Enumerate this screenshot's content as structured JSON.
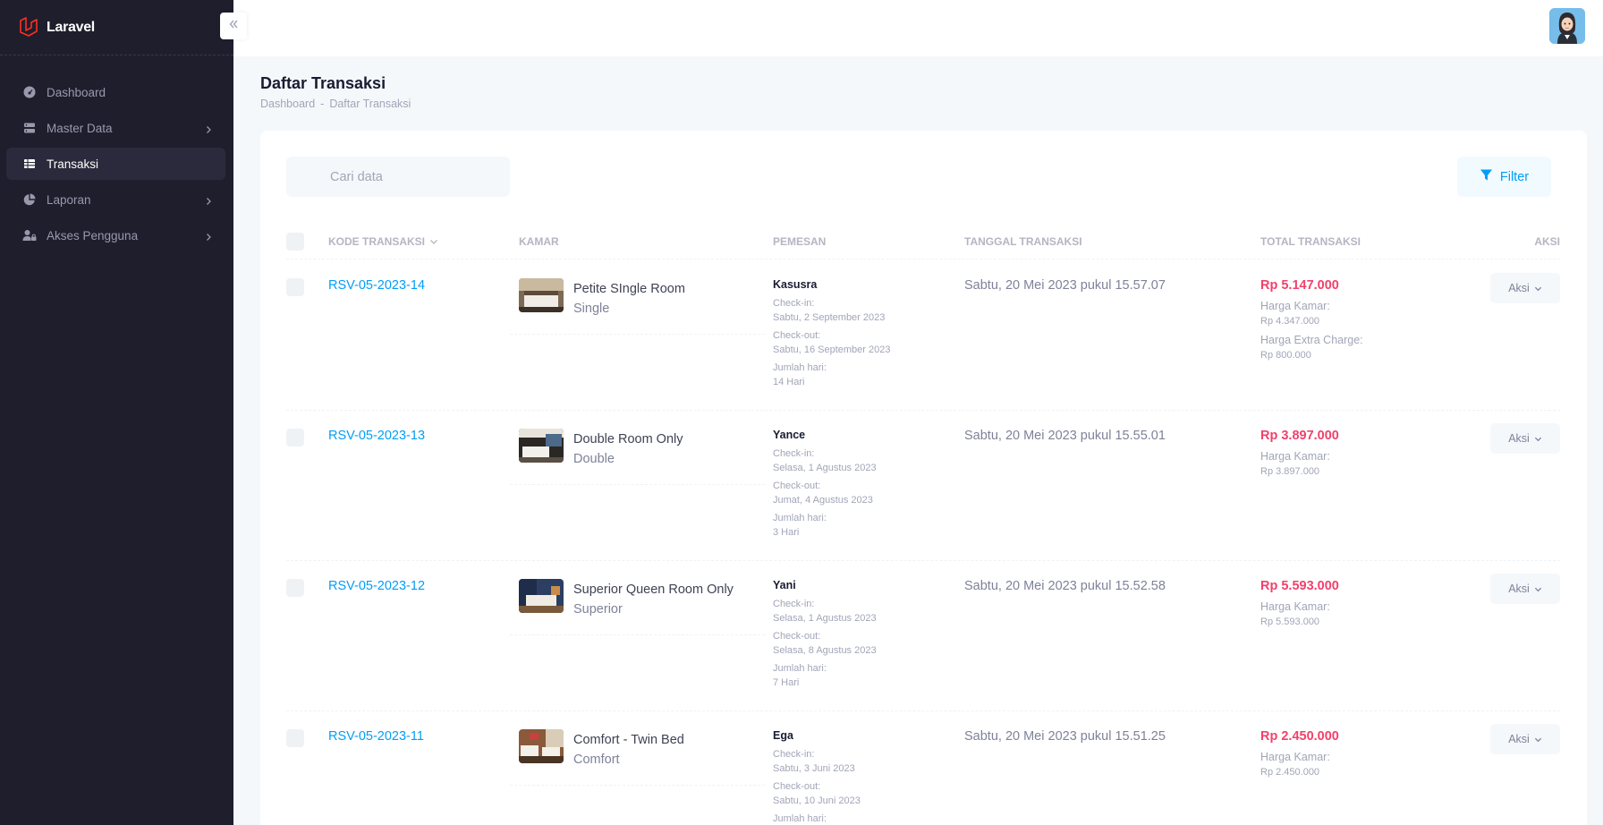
{
  "app": {
    "name": "Laravel"
  },
  "sidebar": {
    "items": [
      {
        "label": "Dashboard",
        "icon": "dashboard-icon",
        "active": false,
        "submenu": false
      },
      {
        "label": "Master Data",
        "icon": "database-icon",
        "active": false,
        "submenu": true
      },
      {
        "label": "Transaksi",
        "icon": "table-icon",
        "active": true,
        "submenu": false
      },
      {
        "label": "Laporan",
        "icon": "pie-chart-icon",
        "active": false,
        "submenu": true
      },
      {
        "label": "Akses Pengguna",
        "icon": "user-lock-icon",
        "active": false,
        "submenu": true
      }
    ]
  },
  "page": {
    "title": "Daftar Transaksi",
    "breadcrumb": [
      "Dashboard",
      "-",
      "Daftar Transaksi"
    ]
  },
  "toolbar": {
    "search_placeholder": "Cari data",
    "filter_label": "Filter"
  },
  "table": {
    "columns": {
      "code": "KODE TRANSAKSI",
      "room": "KAMAR",
      "guest": "PEMESAN",
      "date": "TANGGAL TRANSAKSI",
      "total": "TOTAL TRANSAKSI",
      "action": "AKSI"
    },
    "labels": {
      "checkin": "Check-in:",
      "checkout": "Check-out:",
      "days": "Jumlah hari:",
      "room_price": "Harga Kamar:",
      "extra_charge": "Harga Extra Charge:",
      "action_button": "Aksi"
    },
    "rows": [
      {
        "code": "RSV-05-2023-14",
        "room_name": "Petite SIngle Room",
        "room_type": "Single",
        "guest": "Kasusra",
        "checkin": "Sabtu, 2 September 2023",
        "checkout": "Sabtu, 16 September 2023",
        "days": "14 Hari",
        "date": "Sabtu, 20 Mei 2023 pukul 15.57.07",
        "total": "Rp 5.147.000",
        "room_price": "Rp 4.347.000",
        "extra_charge": "Rp 800.000"
      },
      {
        "code": "RSV-05-2023-13",
        "room_name": "Double Room Only",
        "room_type": "Double",
        "guest": "Yance",
        "checkin": "Selasa, 1 Agustus 2023",
        "checkout": "Jumat, 4 Agustus 2023",
        "days": "3 Hari",
        "date": "Sabtu, 20 Mei 2023 pukul 15.55.01",
        "total": "Rp 3.897.000",
        "room_price": "Rp 3.897.000"
      },
      {
        "code": "RSV-05-2023-12",
        "room_name": "Superior Queen Room Only",
        "room_type": "Superior",
        "guest": "Yani",
        "checkin": "Selasa, 1 Agustus 2023",
        "checkout": "Selasa, 8 Agustus 2023",
        "days": "7 Hari",
        "date": "Sabtu, 20 Mei 2023 pukul 15.52.58",
        "total": "Rp 5.593.000",
        "room_price": "Rp 5.593.000"
      },
      {
        "code": "RSV-05-2023-11",
        "room_name": "Comfort - Twin Bed",
        "room_type": "Comfort",
        "guest": "Ega",
        "checkin": "Sabtu, 3 Juni 2023",
        "checkout": "Sabtu, 10 Juni 2023",
        "days": "",
        "date": "Sabtu, 20 Mei 2023 pukul 15.51.25",
        "total": "Rp 2.450.000",
        "room_price": "Rp 2.450.000"
      }
    ]
  }
}
